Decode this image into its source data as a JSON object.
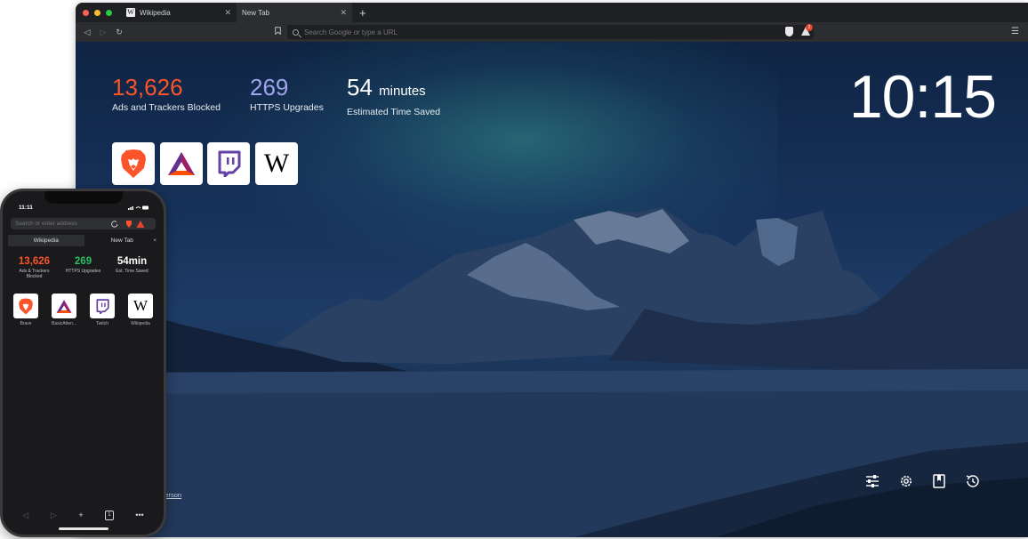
{
  "desktop": {
    "tabs": [
      {
        "title": "Wikipedia",
        "favicon": "W",
        "active": false
      },
      {
        "title": "New Tab",
        "active": true
      }
    ],
    "new_tab_symbol": "+",
    "url_placeholder": "Search Google or type a URL",
    "rewards_badge": "2",
    "stats": {
      "ads_blocked": {
        "value": "13,626",
        "label": "Ads and Trackers Blocked",
        "color": "#fb542b"
      },
      "https_upgrades": {
        "value": "269",
        "label": "HTTPS Upgrades",
        "color": "#a0a5eb"
      },
      "time_saved": {
        "value": "54",
        "unit": "minutes",
        "label": "Estimated Time Saved",
        "color": "#ffffff"
      }
    },
    "clock": "10:15",
    "top_sites": [
      {
        "name": "Brave",
        "icon": "brave-lion-icon"
      },
      {
        "name": "Basic Attention Token",
        "icon": "bat-triangle-icon"
      },
      {
        "name": "Twitch",
        "icon": "twitch-icon"
      },
      {
        "name": "Wikipedia",
        "icon": "wikipedia-w-icon",
        "glyph": "W"
      }
    ],
    "photo_credit": "nderson",
    "controls": [
      "customize-icon",
      "settings-icon",
      "bookmarks-icon",
      "history-icon"
    ]
  },
  "phone": {
    "time": "11:11",
    "url_placeholder": "Search or enter address",
    "tabs": [
      {
        "title": "Wikipedia",
        "active": true
      },
      {
        "title": "New Tab",
        "active": false,
        "close": "×"
      }
    ],
    "stats": [
      {
        "value": "13,626",
        "label": "Ads & Trackers Blocked",
        "color": "#fb542b"
      },
      {
        "value": "269",
        "label": "HTTPS Upgrades",
        "color": "#2dbe60"
      },
      {
        "value": "54min",
        "label": "Est. Time Saved",
        "color": "#ffffff"
      }
    ],
    "top_sites": [
      {
        "name": "Brave",
        "icon": "brave-lion-icon"
      },
      {
        "name": "BasicAtten...",
        "icon": "bat-triangle-icon"
      },
      {
        "name": "Twitch",
        "icon": "twitch-icon"
      },
      {
        "name": "Wikipedia",
        "icon": "wikipedia-w-icon",
        "glyph": "W"
      }
    ],
    "bottom_bar": {
      "back": "◁",
      "forward": "▷",
      "add": "+",
      "tabs": "1",
      "more": "•••"
    }
  }
}
